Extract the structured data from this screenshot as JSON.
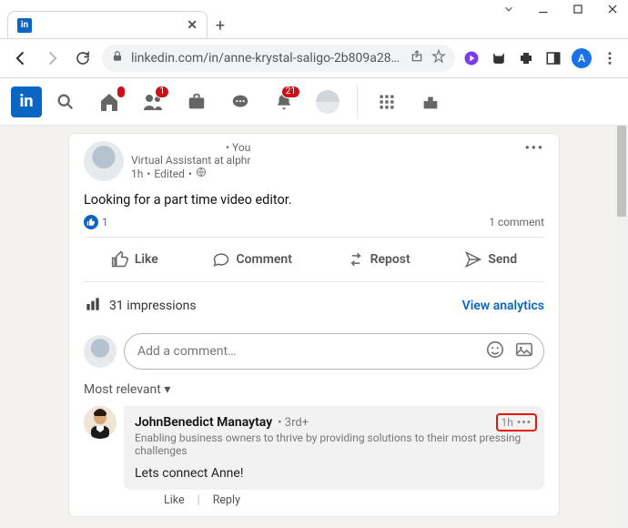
{
  "browser": {
    "url": "linkedin.com/in/anne-krystal-saligo-2b809a28…",
    "profile_letter": "A"
  },
  "nav": {
    "badge_home": "",
    "badge_network": "1",
    "badge_notif": "21"
  },
  "post": {
    "you_label": "• You",
    "subtitle": "Virtual Assistant at alphr",
    "time": "1h",
    "edited": "Edited",
    "body": "Looking for a part time video editor.",
    "like_count": "1",
    "comment_count": "1 comment",
    "actions": {
      "like": "Like",
      "comment": "Comment",
      "repost": "Repost",
      "send": "Send"
    },
    "impressions": "31 impressions",
    "view_analytics": "View analytics",
    "add_comment_placeholder": "Add a comment…",
    "sort_label": "Most relevant",
    "comment": {
      "name": "JohnBenedict Manaytay",
      "degree": "3rd+",
      "headline": "Enabling business owners to thrive by providing solutions to their most pressing challenges",
      "text": "Lets connect Anne!",
      "time": "1h",
      "like": "Like",
      "reply": "Reply"
    }
  }
}
